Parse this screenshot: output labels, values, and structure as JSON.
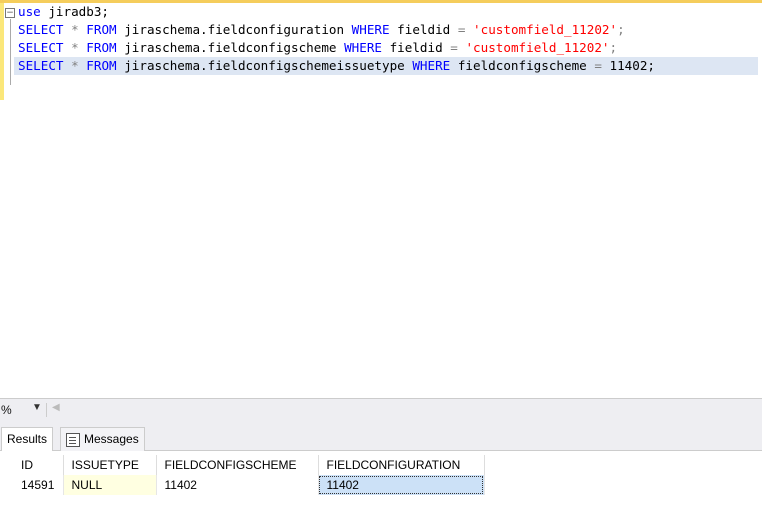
{
  "editor": {
    "line1": {
      "kw": "use",
      "rest": " jiradb3;"
    },
    "line2": {
      "select": "SELECT",
      "star": "*",
      "from": "FROM",
      "table": " jiraschema.fieldconfiguration ",
      "where": "WHERE",
      "col": " fieldid ",
      "eq": "=",
      "str": "'customfield_11202'",
      "end": ";"
    },
    "line3": {
      "select": "SELECT",
      "star": "*",
      "from": "FROM",
      "table": " jiraschema.fieldconfigscheme ",
      "where": "WHERE",
      "col": " fieldid ",
      "eq": "=",
      "str": "'customfield_11202'",
      "end": ";"
    },
    "line4": {
      "select": "SELECT",
      "star": "*",
      "from": "FROM",
      "table": " jiraschema.fieldconfigschemeissuetype ",
      "where": "WHERE",
      "col": " fieldconfigscheme ",
      "eq": "=",
      "num": " 11402;"
    }
  },
  "statusbar": {
    "zoom": "%",
    "zoom_arrow": "▼",
    "scroll_left": "◀"
  },
  "tabs": {
    "results": "Results",
    "messages": "Messages"
  },
  "grid": {
    "columns": [
      "ID",
      "ISSUETYPE",
      "FIELDCONFIGSCHEME",
      "FIELDCONFIGURATION"
    ],
    "rows": [
      [
        "14591",
        "NULL",
        "11402",
        "11402"
      ]
    ]
  }
}
